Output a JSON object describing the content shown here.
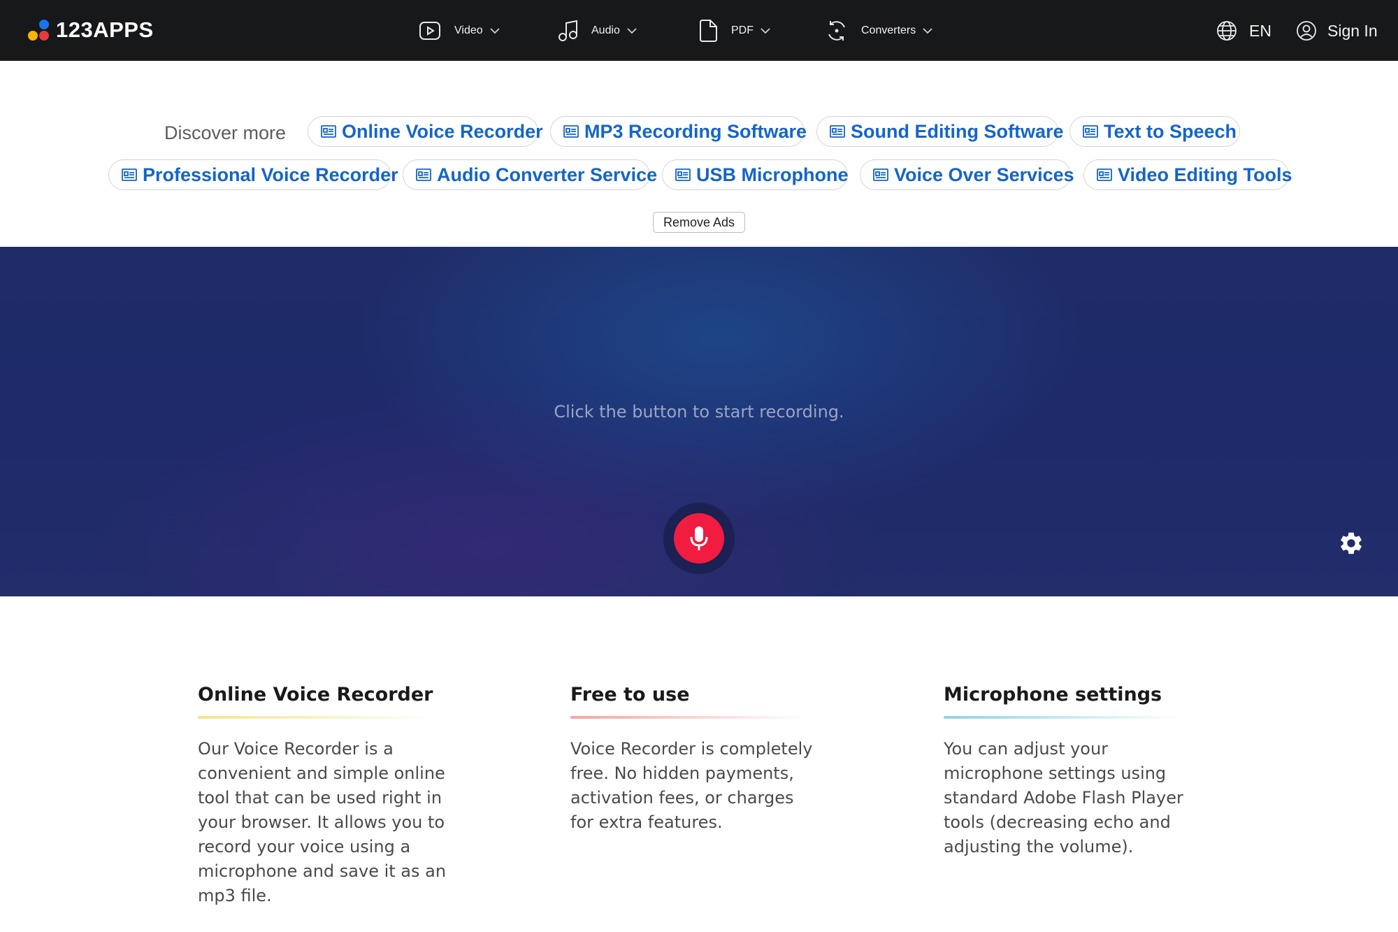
{
  "brand": {
    "name": "123APPS"
  },
  "nav": {
    "items": [
      {
        "label": "Video",
        "icon": "video-play-icon"
      },
      {
        "label": "Audio",
        "icon": "music-note-icon"
      },
      {
        "label": "PDF",
        "icon": "document-icon"
      },
      {
        "label": "Converters",
        "icon": "convert-icon"
      }
    ],
    "language": "EN",
    "sign_in": "Sign In"
  },
  "discover": {
    "label": "Discover more",
    "links": [
      "Online Voice Recorder",
      "MP3 Recording Software",
      "Sound Editing Software",
      "Text to Speech",
      "Professional Voice Recorder",
      "Audio Converter Service",
      "USB Microphone",
      "Voice Over Services",
      "Video Editing Tools"
    ],
    "remove_ads": "Remove Ads"
  },
  "recorder": {
    "hint": "Click the button to start recording.",
    "record_button_icon": "microphone-icon",
    "settings_icon": "gear-icon"
  },
  "features": [
    {
      "title": "Online Voice Recorder",
      "text": "Our Voice Recorder is a convenient and simple online tool that can be used right in your browser. It allows you to record your voice using a microphone and save it as an mp3 file.",
      "accent": "#f3e58a"
    },
    {
      "title": "Free to use",
      "text": "Voice Recorder is completely free. No hidden payments, activation fees, or charges for extra features.",
      "accent": "#f4a6a0"
    },
    {
      "title": "Microphone settings",
      "text": "You can adjust your microphone settings using standard Adobe Flash Player tools (decreasing echo and adjusting the volume).",
      "accent": "#8ed3e6"
    }
  ],
  "colors": {
    "navbar": "#17181a",
    "link_blue": "#1565c8",
    "record_red": "#f21b40",
    "recorder_bg": "#1f2c68"
  }
}
